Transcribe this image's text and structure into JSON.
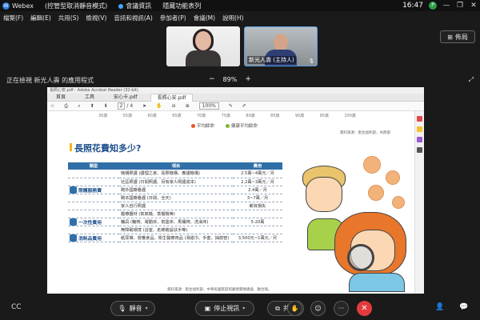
{
  "titlebar": {
    "app_name": "Webex",
    "status": "(控管型取消靜音模式)",
    "meeting_info": "會議資訊",
    "hidden_features": "隱藏功能表列",
    "time": "16:47",
    "badge": "P"
  },
  "menu": [
    "檔案(F)",
    "編輯(E)",
    "共用(S)",
    "檢視(V)",
    "音訊和視訊(A)",
    "參加者(P)",
    "會議(M)",
    "說明(H)"
  ],
  "videos": [
    {
      "label": ""
    },
    {
      "label": "新光人壽 (主持人)"
    }
  ],
  "layout_button": "佈局",
  "share": {
    "viewing_text": "正在檢視 新光人壽 的應用程式",
    "zoom_out": "−",
    "zoom_value": "89%",
    "zoom_in": "+"
  },
  "acrobat": {
    "title": "長照心安.pdf - Adobe Acrobat Reader (32-bit)",
    "tabs": [
      "首頁",
      "工具",
      "安心卡.pdf",
      "長照心安.pdf"
    ],
    "page_current": "2",
    "page_total": "/ 4",
    "zoom": "100%"
  },
  "doc": {
    "axis_labels": [
      "30歲",
      "55歲",
      "60歲",
      "65歲",
      "70歲",
      "75歲",
      "80歲",
      "85歲",
      "90歲",
      "95歲",
      "100歲"
    ],
    "legend": [
      "平均餘命",
      "健康平均餘命"
    ],
    "source_top": "資料來源：衛生福利部、內政部",
    "heading": "長照花費知多少?",
    "table_headers": [
      "類型",
      "項目",
      "費用"
    ],
    "rows": [
      {
        "category": "",
        "item": "機構照護 (護理之家、長照機構、養護機構)",
        "fee": "2.5萬~4萬元／月"
      },
      {
        "category": "",
        "item": "社區照護 (日間照護、另有家人照護成本)",
        "fee": "2.2萬~3萬元／月"
      },
      {
        "category": "照護服務費",
        "item": "聘外國籍看護",
        "fee": "2.4萬／月"
      },
      {
        "category": "",
        "item": "聘本國籍看護 (日間、全天)",
        "fee": "3~7萬／月"
      },
      {
        "category": "",
        "item": "家人自行照護",
        "fee": "薪資損失"
      },
      {
        "category": "",
        "item": "醫療器材 (氣氧機、蒸餾機等)",
        "fee": ""
      },
      {
        "category": "一次性費用",
        "item": "輔具 (輪椅、電動床、氣墊床、馬桶椅、洗澡床)",
        "fee": "5-20萬"
      },
      {
        "category": "",
        "item": "無障礙環境 (浴室、走廊裝設扶手等)",
        "fee": ""
      },
      {
        "category": "消耗品費用",
        "item": "紙尿褲、營養食品、衛生醫療用品 (濕紙巾、手套、抽痰管)",
        "fee": "3,500元~1萬元／月"
      }
    ],
    "source_bottom": "資料來源：衛生福利部、中華民國家庭照顧者關懷總會、聯合報。"
  },
  "controls": {
    "mute": "靜音",
    "stop_video": "停止視訊",
    "share": "共用",
    "more": "···",
    "end": "✕"
  }
}
